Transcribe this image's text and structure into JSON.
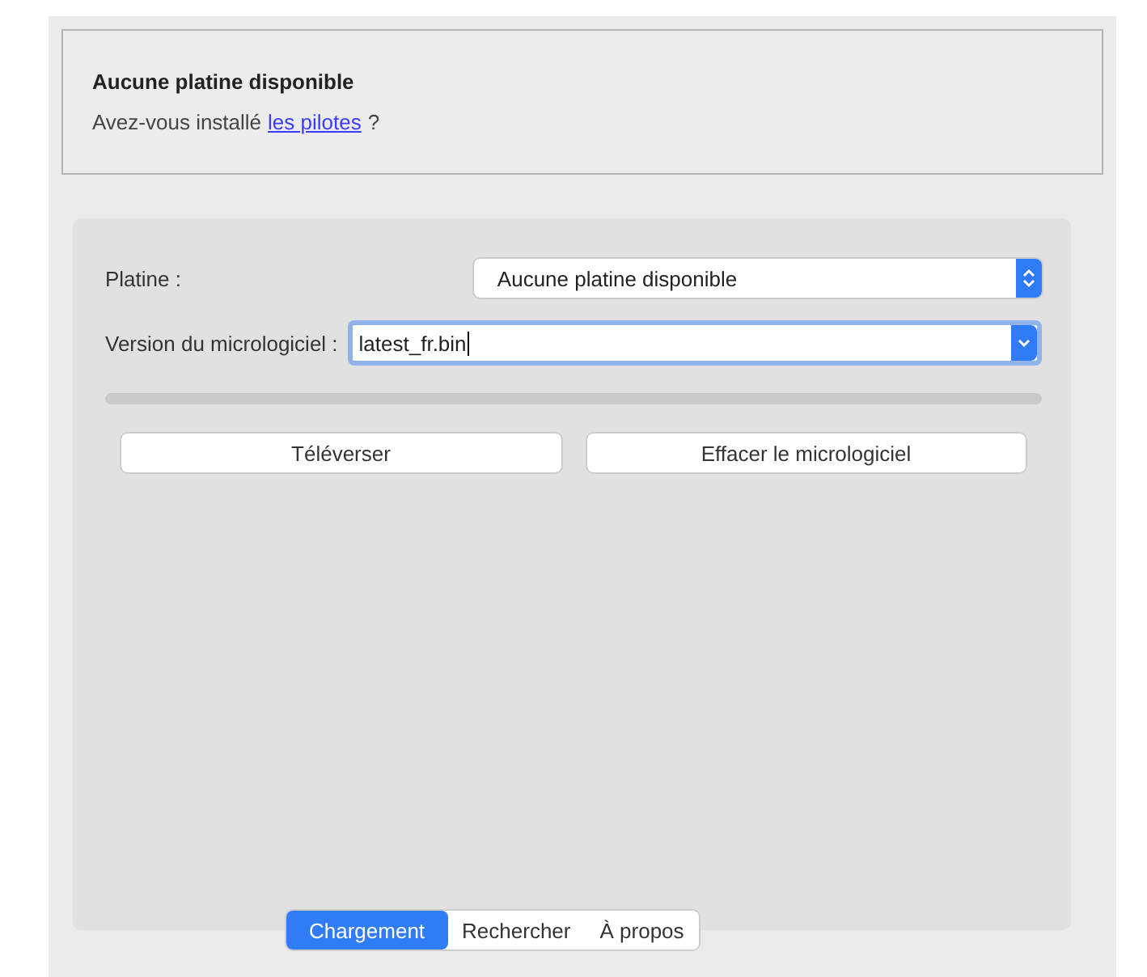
{
  "notice": {
    "title": "Aucune platine disponible",
    "text_before": "Avez-vous installé",
    "link": "les pilotes",
    "text_after": "?"
  },
  "form": {
    "board_label": "Platine :",
    "board_value": "Aucune platine disponible",
    "firmware_label": "Version du micrologiciel :",
    "firmware_value": "latest_fr.bin"
  },
  "progress": {
    "level": 0
  },
  "buttons": [
    "Téléverser",
    "Effacer le micrologiciel"
  ],
  "tabs": [
    {
      "label": "Chargement",
      "selected": true
    },
    {
      "label": "Rechercher",
      "selected": false
    },
    {
      "label": "À propos",
      "selected": false
    }
  ]
}
